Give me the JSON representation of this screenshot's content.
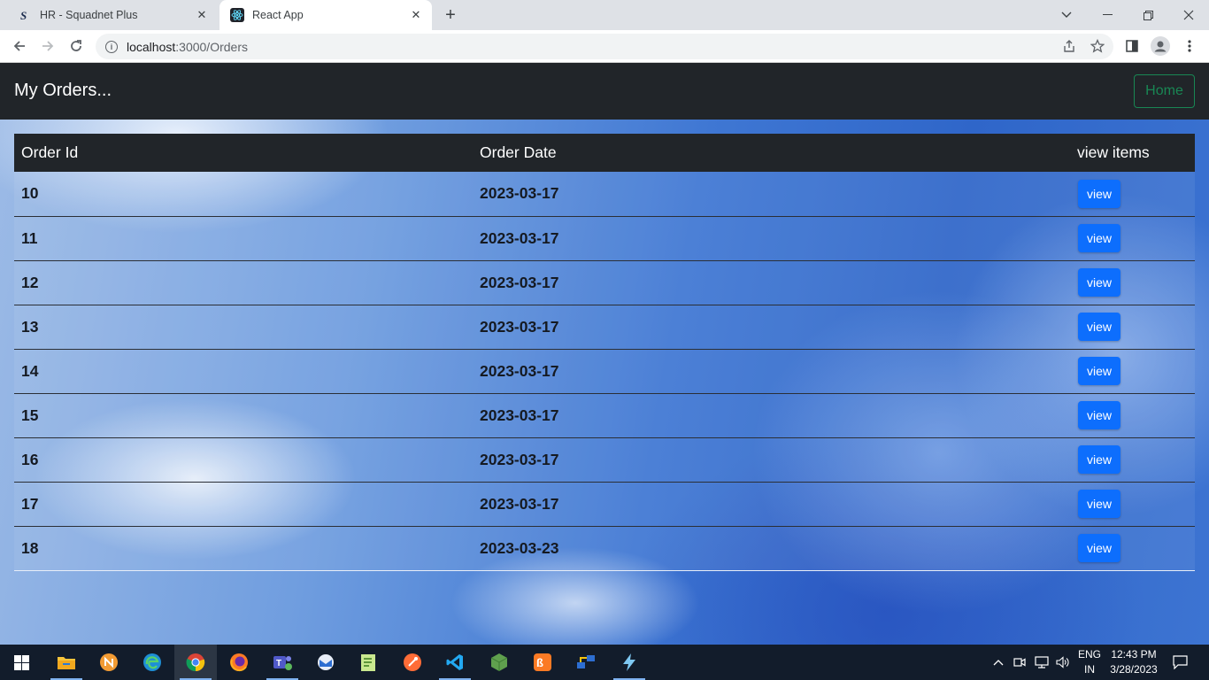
{
  "browser": {
    "tabs": [
      {
        "title": "HR - Squadnet Plus",
        "favicon": "squadnet-s-icon",
        "active": false
      },
      {
        "title": "React App",
        "favicon": "react-icon",
        "active": true
      }
    ],
    "url_host": "localhost",
    "url_path": ":3000/Orders"
  },
  "navbar": {
    "brand": "My Orders...",
    "home_label": "Home"
  },
  "table": {
    "headers": [
      "Order Id",
      "Order Date",
      "view items"
    ],
    "button_label": "view",
    "rows": [
      {
        "id": "10",
        "date": "2023-03-17"
      },
      {
        "id": "11",
        "date": "2023-03-17"
      },
      {
        "id": "12",
        "date": "2023-03-17"
      },
      {
        "id": "13",
        "date": "2023-03-17"
      },
      {
        "id": "14",
        "date": "2023-03-17"
      },
      {
        "id": "15",
        "date": "2023-03-17"
      },
      {
        "id": "16",
        "date": "2023-03-17"
      },
      {
        "id": "17",
        "date": "2023-03-17"
      },
      {
        "id": "18",
        "date": "2023-03-23"
      }
    ]
  },
  "taskbar": {
    "lang_line1": "ENG",
    "lang_line2": "IN",
    "time": "12:43 PM",
    "date": "3/28/2023"
  },
  "colors": {
    "navbar_bg": "#212529",
    "home_outline": "#198754",
    "view_button": "#0d6efd"
  }
}
